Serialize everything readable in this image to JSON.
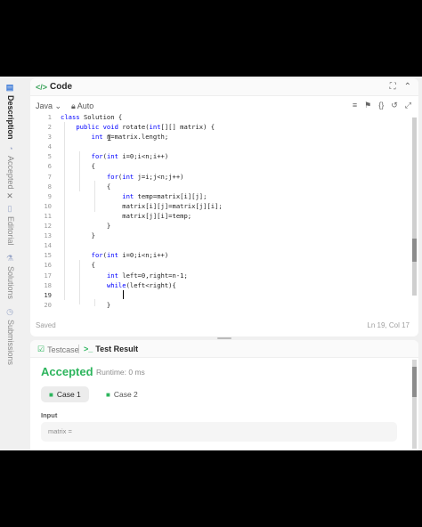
{
  "side_tabs": [
    {
      "label": "Description",
      "icon": "document-icon",
      "active": true
    },
    {
      "label": "Accepted",
      "icon": "history-icon",
      "close": "✕"
    },
    {
      "label": "Editorial",
      "icon": "book-icon"
    },
    {
      "label": "Solutions",
      "icon": "flask-icon"
    },
    {
      "label": "Submissions",
      "icon": "clock-icon"
    }
  ],
  "code_panel": {
    "title": "Code",
    "language": "Java",
    "auto_label": "Auto",
    "status": "Saved",
    "cursor_position": "Ln 19, Col 17"
  },
  "code_lines": [
    {
      "n": "1",
      "text": "class Solution {"
    },
    {
      "n": "2",
      "text": "    public void rotate(int[][] matrix) {"
    },
    {
      "n": "3",
      "text": "        int n=matrix.length;"
    },
    {
      "n": "4",
      "text": ""
    },
    {
      "n": "5",
      "text": "        for(int i=0;i<n;i++)"
    },
    {
      "n": "6",
      "text": "        {"
    },
    {
      "n": "7",
      "text": "            for(int j=i;j<n;j++)"
    },
    {
      "n": "8",
      "text": "            {"
    },
    {
      "n": "9",
      "text": "                int temp=matrix[i][j];"
    },
    {
      "n": "10",
      "text": "                matrix[i][j]=matrix[j][i];"
    },
    {
      "n": "11",
      "text": "                matrix[j][i]=temp;"
    },
    {
      "n": "12",
      "text": "            }"
    },
    {
      "n": "13",
      "text": "        }"
    },
    {
      "n": "14",
      "text": ""
    },
    {
      "n": "15",
      "text": "        for(int i=0;i<n;i++)"
    },
    {
      "n": "16",
      "text": "        {"
    },
    {
      "n": "17",
      "text": "            int left=0,right=n-1;"
    },
    {
      "n": "18",
      "text": "            while(left<right){"
    },
    {
      "n": "19",
      "text": ""
    },
    {
      "n": "20",
      "text": "            }"
    }
  ],
  "test_panel": {
    "tab_testcase": "Testcase",
    "tab_result": "Test Result",
    "verdict": "Accepted",
    "runtime": "Runtime: 0 ms",
    "cases": [
      "Case 1",
      "Case 2"
    ],
    "input_label": "Input",
    "matrix_label": "matrix ="
  },
  "colors": {
    "accent_green": "#2db55d",
    "keyword_blue": "#0000ff"
  }
}
